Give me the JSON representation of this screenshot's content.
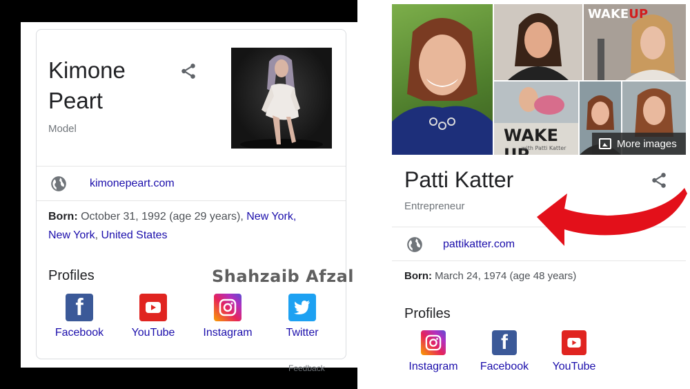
{
  "left_card": {
    "name_line1": "Kimone",
    "name_line2": "Peart",
    "subtitle": "Model",
    "website": "kimonepeart.com",
    "born_label": "Born:",
    "born_text": " October 31, 1992 (age 29 years), ",
    "born_city": "New York,",
    "born_state": "New York",
    "born_sep": ", ",
    "born_country": "United States",
    "profiles_title": "Profiles",
    "profiles": [
      {
        "label": "Facebook",
        "icon": "facebook-icon"
      },
      {
        "label": "YouTube",
        "icon": "youtube-icon"
      },
      {
        "label": "Instagram",
        "icon": "instagram-icon"
      },
      {
        "label": "Twitter",
        "icon": "twitter-icon"
      }
    ],
    "feedback": "Feedback"
  },
  "watermark": "Shahzaib Afzal",
  "right_card": {
    "name": "Patti Katter",
    "subtitle": "Entrepreneur",
    "website": "pattikatter.com",
    "born_label": "Born:",
    "born_text": " March 24, 1974 (age 48 years)",
    "more_images": "More images",
    "wake_up_1": "WAKE",
    "wake_up_1_accent": "UP",
    "wake_up_2": "WAKE UP",
    "wake_sub": "with Patti Katter",
    "profiles_title": "Profiles",
    "profiles": [
      {
        "label": "Instagram",
        "icon": "instagram-icon"
      },
      {
        "label": "Facebook",
        "icon": "facebook-icon"
      },
      {
        "label": "YouTube",
        "icon": "youtube-icon"
      }
    ]
  },
  "colors": {
    "link": "#1a0dab",
    "arrow": "#e3101a",
    "facebook": "#3b5998",
    "youtube": "#e02420",
    "twitter": "#1da1f2"
  }
}
